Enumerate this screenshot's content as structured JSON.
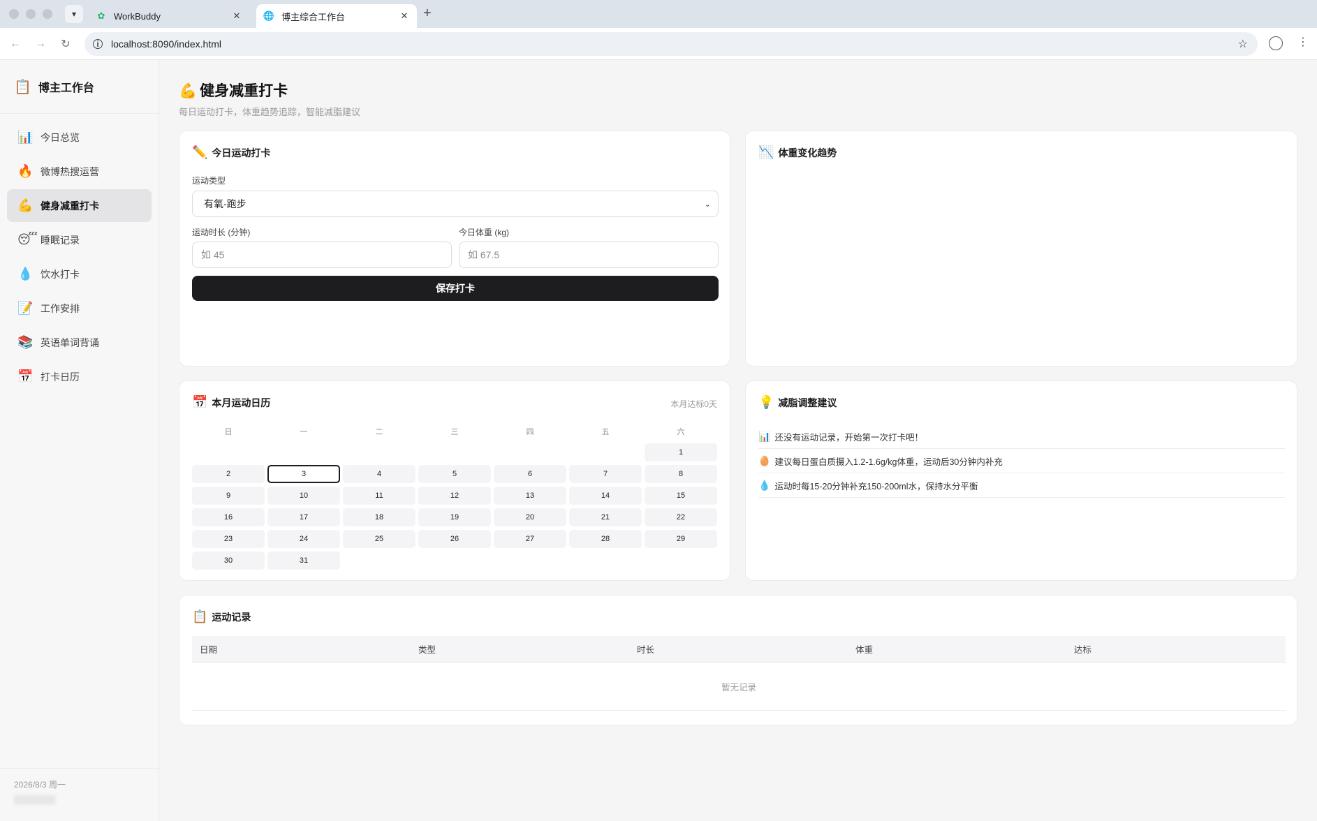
{
  "browser": {
    "tabs": [
      {
        "title": "WorkBuddy",
        "icon": "workbuddy-icon",
        "active": false
      },
      {
        "title": "博主综合工作台",
        "icon": "globe-icon",
        "active": true
      }
    ],
    "url": "localhost:8090/index.html"
  },
  "sidebar": {
    "brand_emoji": "📋",
    "brand": "博主工作台",
    "items": [
      {
        "emoji": "📊",
        "label": "今日总览"
      },
      {
        "emoji": "🔥",
        "label": "微博热搜运营"
      },
      {
        "emoji": "💪",
        "label": "健身减重打卡"
      },
      {
        "emoji": "😴",
        "label": "睡眠记录"
      },
      {
        "emoji": "💧",
        "label": "饮水打卡"
      },
      {
        "emoji": "📝",
        "label": "工作安排"
      },
      {
        "emoji": "📚",
        "label": "英语单词背诵"
      },
      {
        "emoji": "📅",
        "label": "打卡日历"
      }
    ],
    "active_index": 2,
    "footer_date": "2026/8/3 周一"
  },
  "page": {
    "emoji": "💪",
    "title": "健身减重打卡",
    "subtitle": "每日运动打卡，体重趋势追踪，智能减脂建议"
  },
  "checkin": {
    "emoji": "✏️",
    "title": "今日运动打卡",
    "type_label": "运动类型",
    "type_value": "有氧-跑步",
    "duration_label": "运动时长 (分钟)",
    "duration_placeholder": "如 45",
    "weight_label": "今日体重 (kg)",
    "weight_placeholder": "如 67.5",
    "save_label": "保存打卡"
  },
  "trend": {
    "emoji": "📉",
    "title": "体重变化趋势"
  },
  "calendar": {
    "emoji": "📅",
    "title": "本月运动日历",
    "summary": "本月达标0天",
    "weekdays": [
      "日",
      "一",
      "二",
      "三",
      "四",
      "五",
      "六"
    ],
    "leading_blanks": 6,
    "days": 31,
    "today": 3
  },
  "tips": {
    "emoji": "💡",
    "title": "减脂调整建议",
    "items": [
      {
        "emoji": "📊",
        "text": "还没有运动记录，开始第一次打卡吧！"
      },
      {
        "emoji": "🥚",
        "text": "建议每日蛋白质摄入1.2-1.6g/kg体重，运动后30分钟内补充"
      },
      {
        "emoji": "💧",
        "text": "运动时每15-20分钟补充150-200ml水，保持水分平衡"
      }
    ]
  },
  "records": {
    "emoji": "📋",
    "title": "运动记录",
    "columns": [
      "日期",
      "类型",
      "时长",
      "体重",
      "达标"
    ],
    "empty_text": "暂无记录"
  },
  "colors": {
    "accent": "#1d1d1f",
    "active_menu_bg": "#e4e4e6",
    "page_bg": "#f5f5f6"
  }
}
